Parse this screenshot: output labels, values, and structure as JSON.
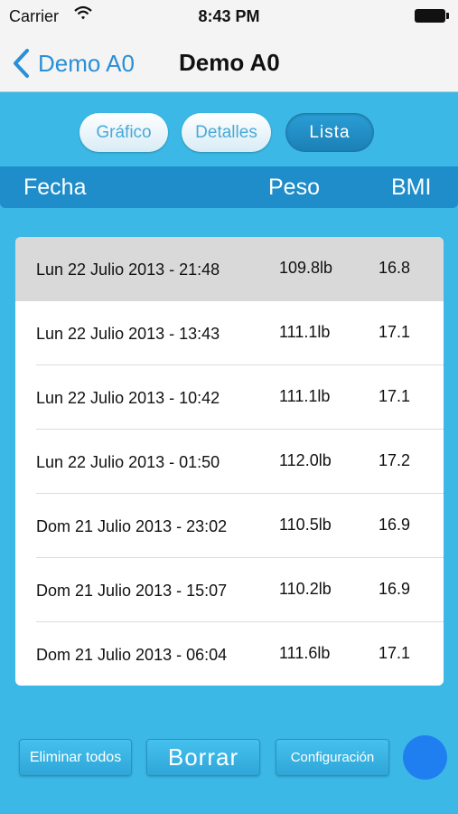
{
  "status_bar": {
    "carrier": "Carrier",
    "time": "8:43 PM"
  },
  "nav": {
    "back_label": "Demo A0",
    "title": "Demo A0",
    "back_icon": "chevron-left-icon"
  },
  "segments": [
    {
      "label": "Gráfico",
      "active": false
    },
    {
      "label": "Detalles",
      "active": false
    },
    {
      "label": "Lista",
      "active": true
    }
  ],
  "columns": {
    "date": "Fecha",
    "weight": "Peso",
    "bmi": "BMI"
  },
  "rows": [
    {
      "date": "Lun 22 Julio 2013 - 21:48",
      "weight": "109.8lb",
      "bmi": "16.8"
    },
    {
      "date": "Lun 22 Julio 2013 - 13:43",
      "weight": "111.1lb",
      "bmi": "17.1"
    },
    {
      "date": "Lun 22 Julio 2013 - 10:42",
      "weight": "111.1lb",
      "bmi": "17.1"
    },
    {
      "date": "Lun 22 Julio 2013 - 01:50",
      "weight": "112.0lb",
      "bmi": "17.2"
    },
    {
      "date": "Dom 21 Julio 2013 - 23:02",
      "weight": "110.5lb",
      "bmi": "16.9"
    },
    {
      "date": "Dom 21 Julio 2013 - 15:07",
      "weight": "110.2lb",
      "bmi": "16.9"
    },
    {
      "date": "Dom 21 Julio 2013 - 06:04",
      "weight": "111.6lb",
      "bmi": "17.1"
    }
  ],
  "toolbar": {
    "delete_all_label": "Eliminar todos",
    "delete_label": "Borrar",
    "settings_label": "Configuración"
  },
  "colors": {
    "background": "#3cb8e6",
    "header_bar": "#1e8dc9",
    "accent": "#2a8fd6",
    "circle_button": "#1f7ff0"
  }
}
